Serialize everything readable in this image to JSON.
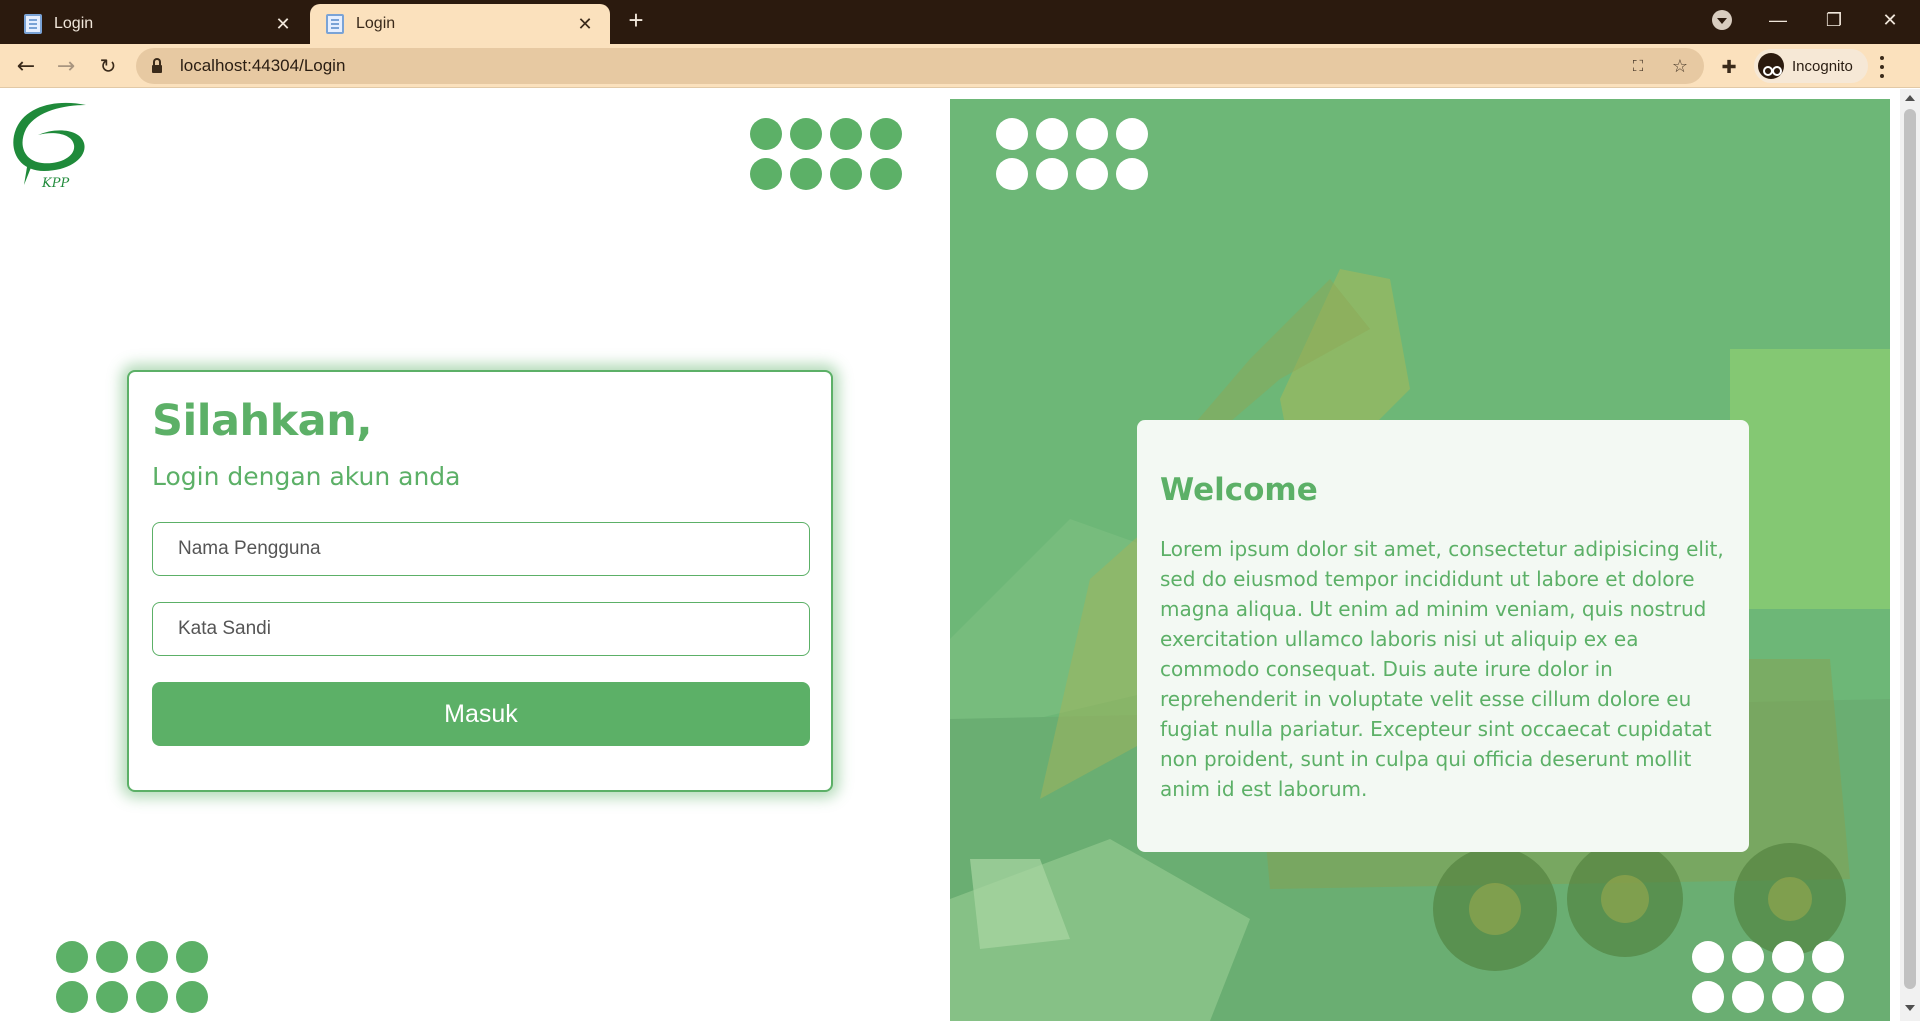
{
  "browser": {
    "tabs": [
      {
        "title": "Login",
        "active": false
      },
      {
        "title": "Login",
        "active": true
      }
    ],
    "new_tab_symbol": "+",
    "close_symbol": "✕",
    "url": "localhost:44304/Login",
    "profile_label": "Incognito",
    "window_controls": {
      "minimize": "—",
      "restore": "❐",
      "close": "✕"
    },
    "icons": [
      "back-arrow-icon",
      "forward-arrow-icon",
      "reload-icon",
      "lock-icon",
      "translate-icon",
      "star-icon",
      "extensions-icon",
      "incognito-icon",
      "kebab-menu-icon"
    ]
  },
  "page": {
    "logo_text": "KPP",
    "login": {
      "heading": "Silahkan,",
      "subheading": "Login dengan akun anda",
      "username_placeholder": "Nama Pengguna",
      "password_placeholder": "Kata Sandi",
      "submit_label": "Masuk"
    },
    "welcome": {
      "title": "Welcome",
      "body": "Lorem ipsum dolor sit amet, consectetur adipisicing elit, sed do eiusmod tempor incididunt ut labore et dolore magna aliqua. Ut enim ad minim veniam, quis nostrud exercitation ullamco laboris nisi ut aliquip ex ea commodo consequat. Duis aute irure dolor in reprehenderit in voluptate velit esse cillum dolore eu fugiat nulla pariatur. Excepteur sint occaecat cupidatat non proident, sunt in culpa qui officia deserunt mollit anim id est laborum."
    }
  },
  "colors": {
    "brand_green": "#5cb067",
    "hero_overlay": "#6db777",
    "welcome_bg": "#f3f9f3",
    "tab_strip": "#2b1a0e",
    "toolbar": "#fbe1bd"
  }
}
